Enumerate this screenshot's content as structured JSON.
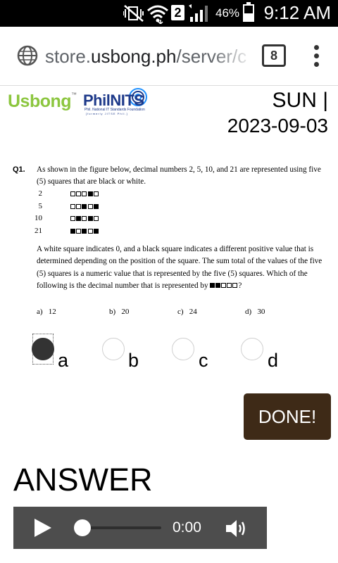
{
  "status_bar": {
    "sim_slot": "2",
    "battery_percent": "46%",
    "time": "9:12 AM",
    "battery_level": 0.46
  },
  "browser": {
    "url_prefix": "store.",
    "url_domain": "usbong.ph",
    "url_path": "/server/c",
    "tab_count": "8"
  },
  "header": {
    "logo_usbong": "Usbong",
    "logo_usbong_tm": "™",
    "logo_philnits": "PhilNITS",
    "logo_philnits_sub": "Phil. National IT Standards Foundation",
    "logo_philnits_sub2": "[formerly JITSE Phil.]",
    "day": "SUN |",
    "date": "2023-09-03"
  },
  "question": {
    "number": "Q1.",
    "intro": "As shown in the figure below, decimal numbers 2, 5, 10, and 21 are represented using five (5) squares that are black or white.",
    "figure_rows": [
      {
        "number": "2",
        "pattern": [
          0,
          0,
          0,
          1,
          0
        ]
      },
      {
        "number": "5",
        "pattern": [
          0,
          0,
          1,
          0,
          1
        ]
      },
      {
        "number": "10",
        "pattern": [
          0,
          1,
          0,
          1,
          0
        ]
      },
      {
        "number": "21",
        "pattern": [
          1,
          0,
          1,
          0,
          1
        ]
      }
    ],
    "paragraph": "A white square indicates 0, and a black square indicates a different positive value that is determined depending on the position of the square. The sum total of the values of the five (5) squares is a numeric value that is represented by the five (5) squares. Which of the following is the decimal number that is represented by",
    "paragraph_pattern": [
      1,
      1,
      0,
      0,
      0
    ],
    "paragraph_end": "?",
    "choices": [
      {
        "label": "a)",
        "value": "12"
      },
      {
        "label": "b)",
        "value": "20"
      },
      {
        "label": "c)",
        "value": "24"
      },
      {
        "label": "d)",
        "value": "30"
      }
    ]
  },
  "options": [
    {
      "label": "a",
      "selected": true
    },
    {
      "label": "b",
      "selected": false
    },
    {
      "label": "c",
      "selected": false
    },
    {
      "label": "d",
      "selected": false
    }
  ],
  "done_button": "DONE!",
  "answer": {
    "title": "ANSWER",
    "audio_time": "0:00",
    "audio_progress": 0
  },
  "colors": {
    "usbong_green": "#8cc63f",
    "philnits_blue": "#1e3a8a",
    "done_bg": "#3e2a17",
    "player_bg": "#4d4d4d"
  }
}
